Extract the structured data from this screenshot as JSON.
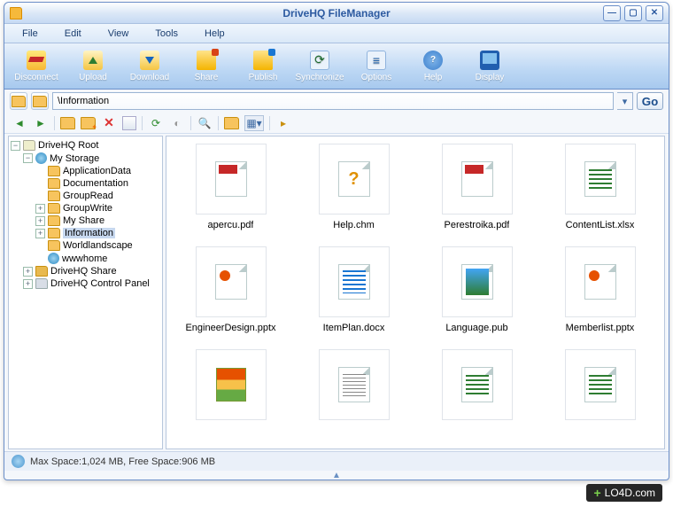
{
  "app": {
    "title": "DriveHQ FileManager"
  },
  "menu": [
    "File",
    "Edit",
    "View",
    "Tools",
    "Help"
  ],
  "toolbar": [
    {
      "id": "disconnect",
      "label": "Disconnect",
      "icon": "ic-disconnect"
    },
    {
      "id": "upload",
      "label": "Upload",
      "icon": "ic-upload"
    },
    {
      "id": "download",
      "label": "Download",
      "icon": "ic-download"
    },
    {
      "id": "share",
      "label": "Share",
      "icon": "ic-share"
    },
    {
      "id": "publish",
      "label": "Publish",
      "icon": "ic-publish"
    },
    {
      "id": "synchronize",
      "label": "Synchronize",
      "icon": "ic-sync"
    },
    {
      "id": "options",
      "label": "Options",
      "icon": "ic-options"
    },
    {
      "id": "help",
      "label": "Help",
      "icon": "ic-help"
    },
    {
      "id": "display",
      "label": "Display",
      "icon": "ic-display"
    }
  ],
  "address": {
    "path": "\\Information",
    "go": "Go"
  },
  "tree": {
    "root": "DriveHQ Root",
    "nodes": [
      {
        "label": "My Storage",
        "icon": "globe",
        "depth": 1,
        "expanded": true
      },
      {
        "label": "ApplicationData",
        "icon": "fld",
        "depth": 2,
        "leaf": true
      },
      {
        "label": "Documentation",
        "icon": "fld",
        "depth": 2,
        "leaf": true
      },
      {
        "label": "GroupRead",
        "icon": "fld",
        "depth": 2,
        "leaf": true
      },
      {
        "label": "GroupWrite",
        "icon": "fld",
        "depth": 2,
        "expandable": true
      },
      {
        "label": "My Share",
        "icon": "fld",
        "depth": 2,
        "expandable": true
      },
      {
        "label": "Information",
        "icon": "fld",
        "depth": 2,
        "expandable": true,
        "selected": true
      },
      {
        "label": "Worldlandscape",
        "icon": "fld",
        "depth": 2,
        "leaf": true
      },
      {
        "label": "wwwhome",
        "icon": "globe",
        "depth": 2,
        "leaf": true
      },
      {
        "label": "DriveHQ Share",
        "icon": "share",
        "depth": 1,
        "expandable": true
      },
      {
        "label": "DriveHQ Control Panel",
        "icon": "panel",
        "depth": 1,
        "expandable": true
      }
    ]
  },
  "files": [
    {
      "name": "apercu.pdf",
      "type": "pdf"
    },
    {
      "name": "Help.chm",
      "type": "chm"
    },
    {
      "name": "Perestroika.pdf",
      "type": "pdf"
    },
    {
      "name": "ContentList.xlsx",
      "type": "xlsx"
    },
    {
      "name": "EngineerDesign.pptx",
      "type": "pptx"
    },
    {
      "name": "ItemPlan.docx",
      "type": "docx"
    },
    {
      "name": "Language.pub",
      "type": "pub"
    },
    {
      "name": "Memberlist.pptx",
      "type": "pptx"
    },
    {
      "name": "",
      "type": "rar"
    },
    {
      "name": "",
      "type": "txt"
    },
    {
      "name": "",
      "type": "xlsx"
    },
    {
      "name": "",
      "type": "xlsx"
    }
  ],
  "status": {
    "text": "Max Space:1,024 MB, Free Space:906 MB"
  },
  "watermark": {
    "text": "LO4D.com"
  }
}
